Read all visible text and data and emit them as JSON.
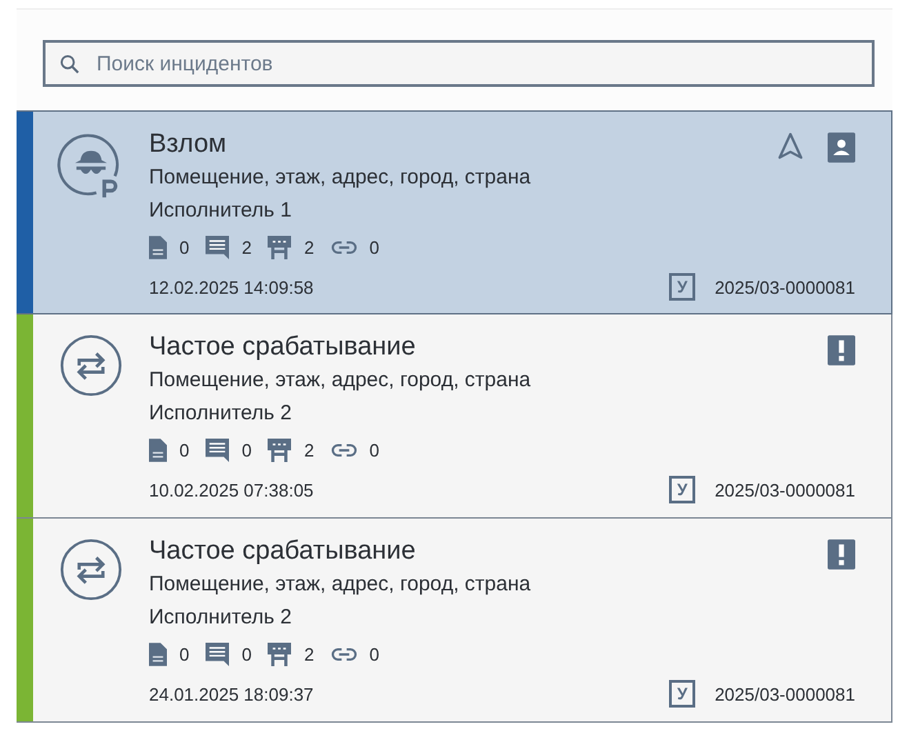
{
  "search": {
    "placeholder": "Поиск инцидентов"
  },
  "incidents": [
    {
      "kind": "intrusion",
      "selected": true,
      "color": "#1f5fa6",
      "title": "Взлом",
      "location": "Помещение, этаж, адрес, город, страна",
      "executor": "Исполнитель 1",
      "counts": [
        {
          "kind": "documents",
          "value": "0"
        },
        {
          "kind": "comments",
          "value": "2"
        },
        {
          "kind": "devices",
          "value": "2"
        },
        {
          "kind": "links",
          "value": "0"
        }
      ],
      "date": "12.02.2025 14:09:58",
      "code": "У",
      "number": "2025/03-0000081",
      "markers": [
        {
          "kind": "navigate"
        },
        {
          "kind": "person"
        }
      ]
    },
    {
      "kind": "frequent",
      "selected": false,
      "color": "#7bb534",
      "title": "Частое срабатывание",
      "location": "Помещение, этаж, адрес, город, страна",
      "executor": "Исполнитель 2",
      "counts": [
        {
          "kind": "documents",
          "value": "0"
        },
        {
          "kind": "comments",
          "value": "0"
        },
        {
          "kind": "devices",
          "value": "2"
        },
        {
          "kind": "links",
          "value": "0"
        }
      ],
      "date": "10.02.2025 07:38:05",
      "code": "У",
      "number": "2025/03-0000081",
      "markers": [
        {
          "kind": "alert"
        }
      ]
    },
    {
      "kind": "frequent",
      "selected": false,
      "color": "#7bb534",
      "title": "Частое срабатывание",
      "location": "Помещение, этаж, адрес, город, страна",
      "executor": "Исполнитель 2",
      "counts": [
        {
          "kind": "documents",
          "value": "0"
        },
        {
          "kind": "comments",
          "value": "0"
        },
        {
          "kind": "devices",
          "value": "2"
        },
        {
          "kind": "links",
          "value": "0"
        }
      ],
      "date": "24.01.2025 18:09:37",
      "code": "У",
      "number": "2025/03-0000081",
      "markers": [
        {
          "kind": "alert"
        }
      ]
    }
  ]
}
